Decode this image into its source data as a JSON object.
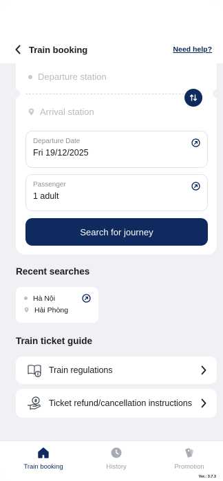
{
  "header": {
    "title": "Train booking",
    "help_link": "Need help?"
  },
  "booking": {
    "departure_placeholder": "Departure station",
    "arrival_placeholder": "Arrival station",
    "date_label": "Departure Date",
    "date_value": "Fri 19/12/2025",
    "passenger_label": "Passenger",
    "passenger_value": "1 adult",
    "search_button": "Search for journey"
  },
  "recent": {
    "title": "Recent searches",
    "items": [
      {
        "from": "Hà Nội",
        "to": "Hải Phòng"
      }
    ]
  },
  "guide": {
    "title": "Train ticket guide",
    "items": [
      {
        "label": "Train regulations",
        "icon": "book-info-icon"
      },
      {
        "label": "Ticket refund/cancellation instructions",
        "icon": "refund-hand-icon"
      }
    ]
  },
  "tabs": [
    {
      "label": "Train booking",
      "icon": "home-icon",
      "active": true
    },
    {
      "label": "History",
      "icon": "clock-icon",
      "active": false
    },
    {
      "label": "Promotion",
      "icon": "promo-icon",
      "active": false
    }
  ],
  "version": "Ver.: 3.7.3",
  "colors": {
    "primary": "#0f2a5e",
    "background": "#f0f1f4"
  }
}
